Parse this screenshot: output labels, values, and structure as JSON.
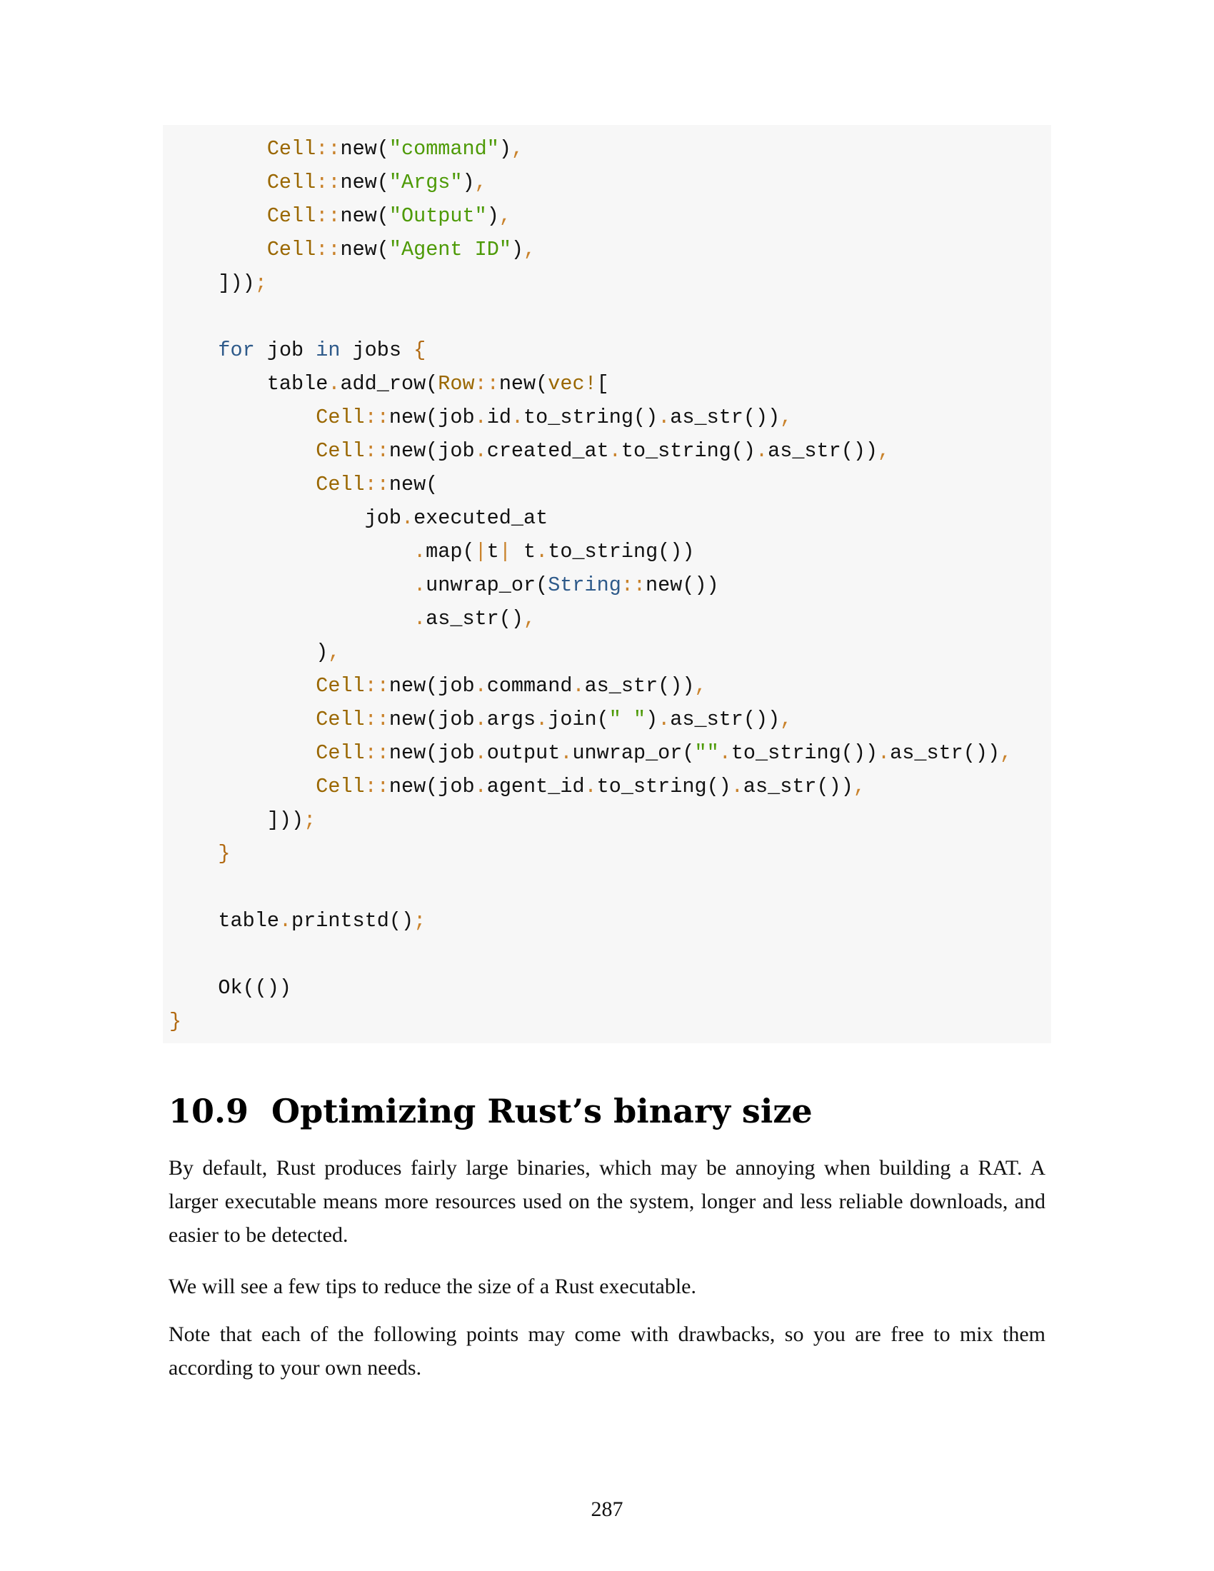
{
  "colors": {
    "code_background": "#f7f7f7",
    "keyword": "#2e5a8a",
    "type_name": "#9a6700",
    "string_literal": "#4d9a06",
    "punctuation": "#c9822b",
    "brace": "#b26a12",
    "body_text": "#111111"
  },
  "code": {
    "lines": [
      [
        {
          "text": "        ",
          "cls": ""
        },
        {
          "text": "Cell",
          "cls": "type-orange"
        },
        {
          "text": "::",
          "cls": "punc-orange"
        },
        {
          "text": "new(",
          "cls": ""
        },
        {
          "text": "\"command\"",
          "cls": "str-green"
        },
        {
          "text": ")",
          "cls": ""
        },
        {
          "text": ",",
          "cls": "punc-orange"
        }
      ],
      [
        {
          "text": "        ",
          "cls": ""
        },
        {
          "text": "Cell",
          "cls": "type-orange"
        },
        {
          "text": "::",
          "cls": "punc-orange"
        },
        {
          "text": "new(",
          "cls": ""
        },
        {
          "text": "\"Args\"",
          "cls": "str-green"
        },
        {
          "text": ")",
          "cls": ""
        },
        {
          "text": ",",
          "cls": "punc-orange"
        }
      ],
      [
        {
          "text": "        ",
          "cls": ""
        },
        {
          "text": "Cell",
          "cls": "type-orange"
        },
        {
          "text": "::",
          "cls": "punc-orange"
        },
        {
          "text": "new(",
          "cls": ""
        },
        {
          "text": "\"Output\"",
          "cls": "str-green"
        },
        {
          "text": ")",
          "cls": ""
        },
        {
          "text": ",",
          "cls": "punc-orange"
        }
      ],
      [
        {
          "text": "        ",
          "cls": ""
        },
        {
          "text": "Cell",
          "cls": "type-orange"
        },
        {
          "text": "::",
          "cls": "punc-orange"
        },
        {
          "text": "new(",
          "cls": ""
        },
        {
          "text": "\"Agent ID\"",
          "cls": "str-green"
        },
        {
          "text": ")",
          "cls": ""
        },
        {
          "text": ",",
          "cls": "punc-orange"
        }
      ],
      [
        {
          "text": "    ]))",
          "cls": ""
        },
        {
          "text": ";",
          "cls": "punc-orange"
        }
      ],
      [],
      [
        {
          "text": "    ",
          "cls": ""
        },
        {
          "text": "for",
          "cls": "kw-blue"
        },
        {
          "text": " job ",
          "cls": ""
        },
        {
          "text": "in",
          "cls": "kw-blue"
        },
        {
          "text": " jobs ",
          "cls": ""
        },
        {
          "text": "{",
          "cls": "brace-orange"
        }
      ],
      [
        {
          "text": "        table",
          "cls": ""
        },
        {
          "text": ".",
          "cls": "punc-orange"
        },
        {
          "text": "add_row(",
          "cls": ""
        },
        {
          "text": "Row",
          "cls": "type-orange"
        },
        {
          "text": "::",
          "cls": "punc-orange"
        },
        {
          "text": "new(",
          "cls": ""
        },
        {
          "text": "vec!",
          "cls": "type-orange"
        },
        {
          "text": "[",
          "cls": ""
        }
      ],
      [
        {
          "text": "            ",
          "cls": ""
        },
        {
          "text": "Cell",
          "cls": "type-orange"
        },
        {
          "text": "::",
          "cls": "punc-orange"
        },
        {
          "text": "new(job",
          "cls": ""
        },
        {
          "text": ".",
          "cls": "punc-orange"
        },
        {
          "text": "id",
          "cls": ""
        },
        {
          "text": ".",
          "cls": "punc-orange"
        },
        {
          "text": "to_string()",
          "cls": ""
        },
        {
          "text": ".",
          "cls": "punc-orange"
        },
        {
          "text": "as_str())",
          "cls": ""
        },
        {
          "text": ",",
          "cls": "punc-orange"
        }
      ],
      [
        {
          "text": "            ",
          "cls": ""
        },
        {
          "text": "Cell",
          "cls": "type-orange"
        },
        {
          "text": "::",
          "cls": "punc-orange"
        },
        {
          "text": "new(job",
          "cls": ""
        },
        {
          "text": ".",
          "cls": "punc-orange"
        },
        {
          "text": "created_at",
          "cls": ""
        },
        {
          "text": ".",
          "cls": "punc-orange"
        },
        {
          "text": "to_string()",
          "cls": ""
        },
        {
          "text": ".",
          "cls": "punc-orange"
        },
        {
          "text": "as_str())",
          "cls": ""
        },
        {
          "text": ",",
          "cls": "punc-orange"
        }
      ],
      [
        {
          "text": "            ",
          "cls": ""
        },
        {
          "text": "Cell",
          "cls": "type-orange"
        },
        {
          "text": "::",
          "cls": "punc-orange"
        },
        {
          "text": "new(",
          "cls": ""
        }
      ],
      [
        {
          "text": "                job",
          "cls": ""
        },
        {
          "text": ".",
          "cls": "punc-orange"
        },
        {
          "text": "executed_at",
          "cls": ""
        }
      ],
      [
        {
          "text": "                    ",
          "cls": ""
        },
        {
          "text": ".",
          "cls": "punc-orange"
        },
        {
          "text": "map(",
          "cls": ""
        },
        {
          "text": "|",
          "cls": "punc-orange"
        },
        {
          "text": "t",
          "cls": ""
        },
        {
          "text": "|",
          "cls": "punc-orange"
        },
        {
          "text": " t",
          "cls": ""
        },
        {
          "text": ".",
          "cls": "punc-orange"
        },
        {
          "text": "to_string())",
          "cls": ""
        }
      ],
      [
        {
          "text": "                    ",
          "cls": ""
        },
        {
          "text": ".",
          "cls": "punc-orange"
        },
        {
          "text": "unwrap_or(",
          "cls": ""
        },
        {
          "text": "String",
          "cls": "kw-blue"
        },
        {
          "text": "::",
          "cls": "punc-orange"
        },
        {
          "text": "new())",
          "cls": ""
        }
      ],
      [
        {
          "text": "                    ",
          "cls": ""
        },
        {
          "text": ".",
          "cls": "punc-orange"
        },
        {
          "text": "as_str()",
          "cls": ""
        },
        {
          "text": ",",
          "cls": "punc-orange"
        }
      ],
      [
        {
          "text": "            )",
          "cls": ""
        },
        {
          "text": ",",
          "cls": "punc-orange"
        }
      ],
      [
        {
          "text": "            ",
          "cls": ""
        },
        {
          "text": "Cell",
          "cls": "type-orange"
        },
        {
          "text": "::",
          "cls": "punc-orange"
        },
        {
          "text": "new(job",
          "cls": ""
        },
        {
          "text": ".",
          "cls": "punc-orange"
        },
        {
          "text": "command",
          "cls": ""
        },
        {
          "text": ".",
          "cls": "punc-orange"
        },
        {
          "text": "as_str())",
          "cls": ""
        },
        {
          "text": ",",
          "cls": "punc-orange"
        }
      ],
      [
        {
          "text": "            ",
          "cls": ""
        },
        {
          "text": "Cell",
          "cls": "type-orange"
        },
        {
          "text": "::",
          "cls": "punc-orange"
        },
        {
          "text": "new(job",
          "cls": ""
        },
        {
          "text": ".",
          "cls": "punc-orange"
        },
        {
          "text": "args",
          "cls": ""
        },
        {
          "text": ".",
          "cls": "punc-orange"
        },
        {
          "text": "join(",
          "cls": ""
        },
        {
          "text": "\" \"",
          "cls": "str-green"
        },
        {
          "text": ")",
          "cls": ""
        },
        {
          "text": ".",
          "cls": "punc-orange"
        },
        {
          "text": "as_str())",
          "cls": ""
        },
        {
          "text": ",",
          "cls": "punc-orange"
        }
      ],
      [
        {
          "text": "            ",
          "cls": ""
        },
        {
          "text": "Cell",
          "cls": "type-orange"
        },
        {
          "text": "::",
          "cls": "punc-orange"
        },
        {
          "text": "new(job",
          "cls": ""
        },
        {
          "text": ".",
          "cls": "punc-orange"
        },
        {
          "text": "output",
          "cls": ""
        },
        {
          "text": ".",
          "cls": "punc-orange"
        },
        {
          "text": "unwrap_or(",
          "cls": ""
        },
        {
          "text": "\"\"",
          "cls": "str-green"
        },
        {
          "text": ".",
          "cls": "punc-orange"
        },
        {
          "text": "to_string())",
          "cls": ""
        },
        {
          "text": ".",
          "cls": "punc-orange"
        },
        {
          "text": "as_str())",
          "cls": ""
        },
        {
          "text": ",",
          "cls": "punc-orange"
        }
      ],
      [
        {
          "text": "            ",
          "cls": ""
        },
        {
          "text": "Cell",
          "cls": "type-orange"
        },
        {
          "text": "::",
          "cls": "punc-orange"
        },
        {
          "text": "new(job",
          "cls": ""
        },
        {
          "text": ".",
          "cls": "punc-orange"
        },
        {
          "text": "agent_id",
          "cls": ""
        },
        {
          "text": ".",
          "cls": "punc-orange"
        },
        {
          "text": "to_string()",
          "cls": ""
        },
        {
          "text": ".",
          "cls": "punc-orange"
        },
        {
          "text": "as_str())",
          "cls": ""
        },
        {
          "text": ",",
          "cls": "punc-orange"
        }
      ],
      [
        {
          "text": "        ]))",
          "cls": ""
        },
        {
          "text": ";",
          "cls": "punc-orange"
        }
      ],
      [
        {
          "text": "    ",
          "cls": ""
        },
        {
          "text": "}",
          "cls": "brace-orange"
        }
      ],
      [],
      [
        {
          "text": "    table",
          "cls": ""
        },
        {
          "text": ".",
          "cls": "punc-orange"
        },
        {
          "text": "printstd()",
          "cls": ""
        },
        {
          "text": ";",
          "cls": "punc-orange"
        }
      ],
      [],
      [
        {
          "text": "    Ok(())",
          "cls": ""
        }
      ],
      [
        {
          "text": "}",
          "cls": "brace-orange"
        }
      ]
    ]
  },
  "section": {
    "number": "10.9",
    "title": "Optimizing Rust’s binary size"
  },
  "paragraphs": [
    "By default, Rust produces fairly large binaries, which may be annoying when building a RAT. A larger executable means more resources used on the system, longer and less reliable downloads, and easier to be detected.",
    "We will see a few tips to reduce the size of a Rust executable.",
    "Note that each of the following points may come with drawbacks, so you are free to mix them according to your own needs."
  ],
  "page_number": "287"
}
